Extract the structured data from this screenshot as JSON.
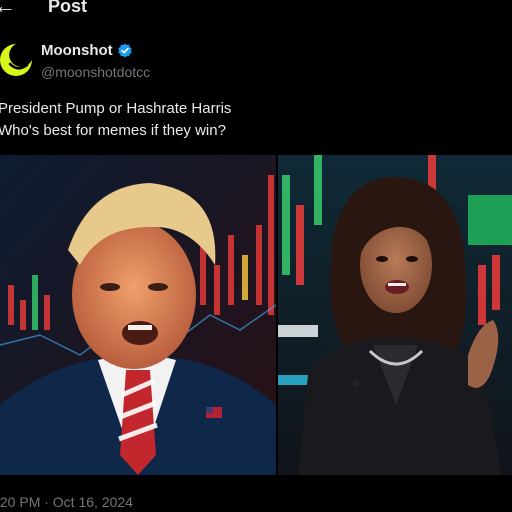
{
  "header": {
    "title": "Post",
    "back_icon": "arrow-left-icon"
  },
  "author": {
    "display_name": "Moonshot",
    "handle": "@moonshotdotcc",
    "avatar_icon": "moon-smiley-icon",
    "verified_icon": "verified-badge-icon",
    "accent": "#1d9bf0",
    "avatar_color": "#d7f51b"
  },
  "post": {
    "text": "President Pump or Hashrate Harris\nWho's best for memes if they win?"
  },
  "media": {
    "left_description_icon": "photo-left",
    "right_description_icon": "photo-right"
  },
  "meta": {
    "timestamp": ":20 PM · Oct 16, 2024"
  }
}
